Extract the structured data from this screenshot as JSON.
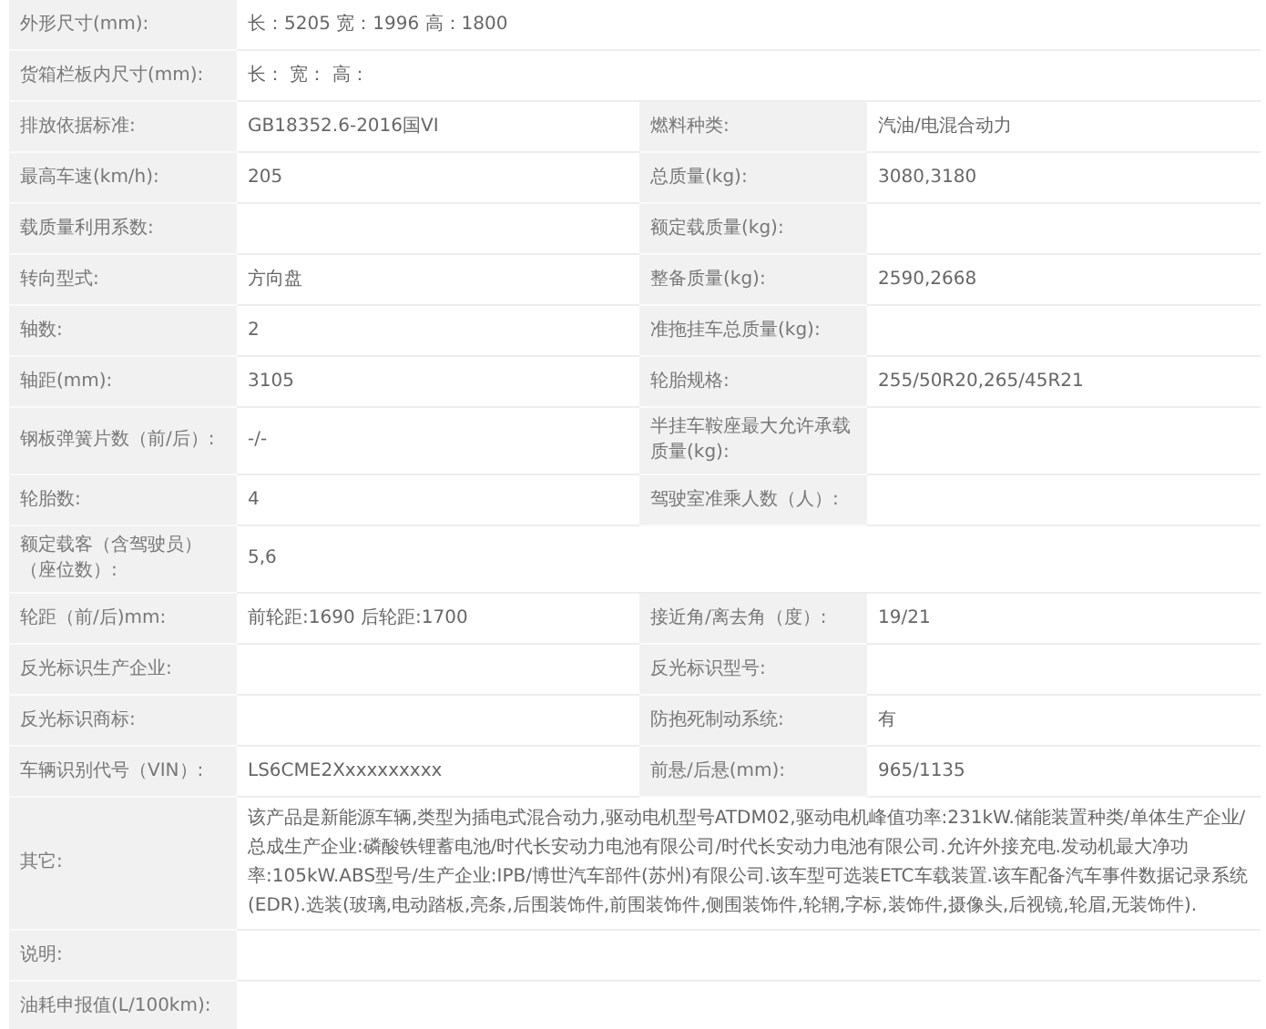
{
  "rows": [
    {
      "kind": "pair",
      "pairs": [
        {
          "label": "外形尺寸(mm):",
          "value": "长：5205 宽：1996 高：1800"
        }
      ]
    },
    {
      "kind": "pair",
      "pairs": [
        {
          "label": "货箱栏板内尺寸(mm):",
          "value": "长： 宽： 高："
        }
      ]
    },
    {
      "kind": "pair",
      "pairs": [
        {
          "label": "排放依据标准:",
          "value": "GB18352.6-2016国VI"
        },
        {
          "label": "燃料种类:",
          "value": "汽油/电混合动力"
        }
      ]
    },
    {
      "kind": "pair",
      "pairs": [
        {
          "label": "最高车速(km/h):",
          "value": "205"
        },
        {
          "label": "总质量(kg):",
          "value": "3080,3180"
        }
      ]
    },
    {
      "kind": "pair",
      "pairs": [
        {
          "label": "载质量利用系数:"
        },
        {
          "label": "额定载质量(kg):"
        }
      ]
    },
    {
      "kind": "pair",
      "pairs": [
        {
          "label": "转向型式:",
          "value": "方向盘"
        },
        {
          "label": "整备质量(kg):",
          "value": "2590,2668"
        }
      ]
    },
    {
      "kind": "pair",
      "pairs": [
        {
          "label": "轴数:",
          "value": "2"
        },
        {
          "label": "准拖挂车总质量(kg):"
        }
      ]
    },
    {
      "kind": "pair",
      "pairs": [
        {
          "label": "轴距(mm):",
          "value": "3105"
        },
        {
          "label": "轮胎规格:",
          "value": "255/50R20,265/45R21"
        }
      ]
    },
    {
      "kind": "pair",
      "pairs": [
        {
          "label": "钢板弹簧片数（前/后）:",
          "value": "-/-"
        },
        {
          "label": "半挂车鞍座最大允许承载质量(kg):"
        }
      ]
    },
    {
      "kind": "pair",
      "pairs": [
        {
          "label": "轮胎数:",
          "value": "4"
        },
        {
          "label": "驾驶室准乘人数（人）:"
        }
      ]
    },
    {
      "kind": "pair",
      "pairs": [
        {
          "label": "额定载客（含驾驶员）（座位数）:",
          "value": "5,6"
        }
      ]
    },
    {
      "kind": "pair",
      "pairs": [
        {
          "label": "轮距（前/后)mm:",
          "value": "前轮距:1690 后轮距:1700"
        },
        {
          "label": "接近角/离去角（度）:",
          "value": "19/21"
        }
      ]
    },
    {
      "kind": "pair",
      "pairs": [
        {
          "label": "反光标识生产企业:"
        },
        {
          "label": "反光标识型号:"
        }
      ]
    },
    {
      "kind": "pair",
      "pairs": [
        {
          "label": "反光标识商标:"
        },
        {
          "label": "防抱死制动系统:",
          "value": "有"
        }
      ]
    },
    {
      "kind": "pair",
      "pairs": [
        {
          "label": "车辆识别代号（VIN）:",
          "value": "LS6CME2Xxxxxxxxxx"
        },
        {
          "label": "前悬/后悬(mm):",
          "value": "965/1135"
        }
      ]
    },
    {
      "kind": "wide",
      "pairs": [
        {
          "label": "其它:",
          "value": "该产品是新能源车辆,类型为插电式混合动力,驱动电机型号ATDM02,驱动电机峰值功率:231kW.储能装置种类/单体生产企业/总成生产企业:磷酸铁锂蓄电池/时代长安动力电池有限公司/时代长安动力电池有限公司.允许外接充电.发动机最大净功率:105kW.ABS型号/生产企业:IPB/博世汽车部件(苏州)有限公司.该车型可选装ETC车载装置.该车配备汽车事件数据记录系统(EDR).选装(玻璃,电动踏板,亮条,后围装饰件,前围装饰件,侧围装饰件,轮辋,字标,装饰件,摄像头,后视镜,轮眉,无装饰件)."
        }
      ]
    },
    {
      "kind": "wide",
      "pairs": [
        {
          "label": "说明:"
        }
      ]
    },
    {
      "kind": "wide",
      "pairs": [
        {
          "label": "油耗申报值(L/100km):"
        }
      ]
    }
  ]
}
